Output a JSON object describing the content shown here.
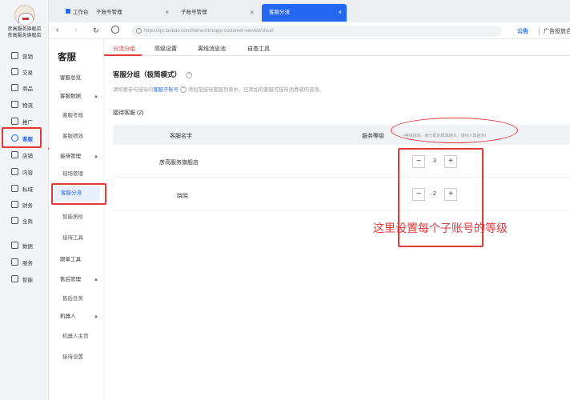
{
  "store": {
    "name_line1": "彦高服务旗舰店",
    "name_line2": "彦高服务旗舰店"
  },
  "left_nav": [
    {
      "label": "营销",
      "icon": "megaphone-icon"
    },
    {
      "label": "交易",
      "icon": "receipt-icon"
    },
    {
      "label": "商品",
      "icon": "bag-icon"
    },
    {
      "label": "物流",
      "icon": "truck-icon"
    },
    {
      "label": "推广",
      "icon": "chart-icon"
    },
    {
      "label": "客服",
      "icon": "headset-icon",
      "active": true
    },
    {
      "label": "店铺",
      "icon": "store-icon"
    },
    {
      "label": "内容",
      "icon": "content-icon"
    },
    {
      "label": "私域",
      "icon": "user-icon"
    },
    {
      "label": "财务",
      "icon": "wallet-icon"
    },
    {
      "label": "全商",
      "icon": "globe-icon"
    },
    {
      "label": "数据",
      "icon": "data-icon"
    },
    {
      "label": "服务",
      "icon": "grid-icon"
    },
    {
      "label": "智能",
      "icon": "spark-icon"
    }
  ],
  "browser_tabs": [
    {
      "label": "工作台",
      "closable": false
    },
    {
      "label": "子账号管理",
      "closable": true
    },
    {
      "label": "子账号管理",
      "closable": true
    },
    {
      "label": "客服分流",
      "closable": true,
      "active": true
    }
  ],
  "address_bar": {
    "url": "https://qn.taobao.com/home.htm/app-customer-service/shunt"
  },
  "header_right": {
    "notice": "公告",
    "ad": "广告投放合规"
  },
  "subnav": {
    "title": "客服",
    "items": [
      {
        "label": "客服总览",
        "level": 1
      },
      {
        "label": "客服数据",
        "level": 1,
        "caret": "▲"
      },
      {
        "label": "客服考核",
        "level": 2
      },
      {
        "label": "客服绩效",
        "level": 2
      },
      {
        "label": "接待管理",
        "level": 1,
        "caret": "▲"
      },
      {
        "label": "现场管理",
        "level": 2
      },
      {
        "label": "客服分流",
        "level": 2,
        "active": true
      },
      {
        "label": "智能质检",
        "level": 2
      },
      {
        "label": "接待工具",
        "level": 2
      },
      {
        "label": "跟单工具",
        "level": 1
      },
      {
        "label": "售后管理",
        "level": 1,
        "caret": "▲"
      },
      {
        "label": "售后任务",
        "level": 2
      },
      {
        "label": "机器人",
        "level": 1,
        "caret": "▲"
      },
      {
        "label": "机器人主页",
        "level": 2
      },
      {
        "label": "接待设置",
        "level": 2
      }
    ]
  },
  "page_tabs": [
    {
      "label": "分流分组",
      "active": true
    },
    {
      "label": "高级设置"
    },
    {
      "label": "离线消息池"
    },
    {
      "label": "自查工具"
    }
  ],
  "section": {
    "title": "客服分组（极简模式）",
    "help": "?",
    "desc_pre": "请将要参与接待的",
    "desc_link": "客服子账号",
    "desc_post": "添加至接待客服列表中，已添加的客服可接待消费者的咨询。",
    "count_label": "接待客服 (2)"
  },
  "table": {
    "col_name": "客服名字",
    "col_level": "服务等级",
    "level_hint": "(等级越高，被分配的概率越大，接待人数越多)",
    "rows": [
      {
        "name": "彦高服务旗舰店",
        "level": "3"
      },
      {
        "name": "晓晓",
        "level": "2"
      }
    ],
    "minus": "−",
    "plus": "+"
  },
  "annotation": "这里设置每个子账号的等级",
  "colors": {
    "accent": "#2468f2",
    "annotation_red": "#e2393b"
  }
}
